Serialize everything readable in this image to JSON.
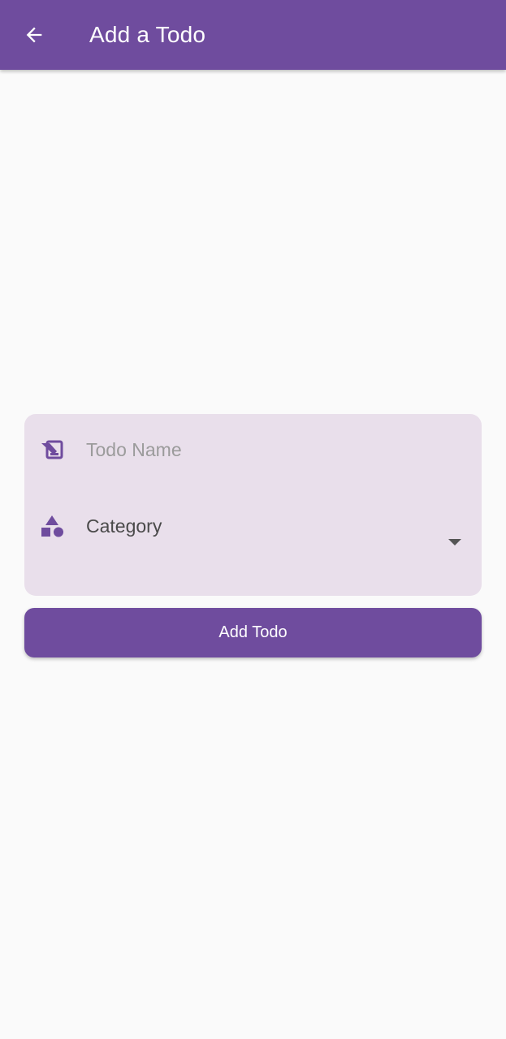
{
  "app_bar": {
    "title": "Add a Todo",
    "back_icon": "arrow-back-icon",
    "background": "#6f4c9e"
  },
  "form": {
    "name_field": {
      "placeholder": "Todo Name",
      "value": "",
      "icon": "edit-note-icon"
    },
    "category_field": {
      "label": "Category",
      "selected": "",
      "icon": "category-shapes-icon",
      "dropdown_icon": "arrow-drop-down-icon"
    },
    "background": "#e9dfeb"
  },
  "actions": {
    "add_label": "Add Todo"
  },
  "colors": {
    "primary": "#6f4c9e",
    "surface": "#fafafa",
    "field_bg": "#e9dfeb"
  }
}
